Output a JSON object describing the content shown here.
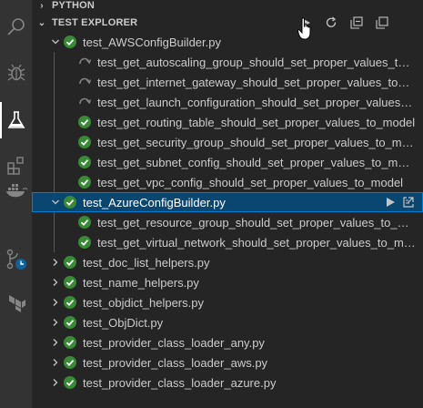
{
  "sections": {
    "python_label": "PYTHON",
    "test_explorer_label": "TEST EXPLORER"
  },
  "toolbar": {
    "icons": [
      "run-all-icon",
      "refresh-icon",
      "collapse-all-icon",
      "show-output-icon"
    ]
  },
  "colors": {
    "pass": "#388a34",
    "skipped": "#848484",
    "selection": "#094771",
    "focus_border": "#007fd4"
  },
  "tree": {
    "suite1": {
      "label": "test_AWSConfigBuilder.py",
      "tests": [
        {
          "label": "test_get_autoscaling_group_should_set_proper_values_to_model",
          "status": "skipped"
        },
        {
          "label": "test_get_internet_gateway_should_set_proper_values_to_model",
          "status": "skipped"
        },
        {
          "label": "test_get_launch_configuration_should_set_proper_values_to_model",
          "status": "skipped"
        },
        {
          "label": "test_get_routing_table_should_set_proper_values_to_model",
          "status": "passed"
        },
        {
          "label": "test_get_security_group_should_set_proper_values_to_model",
          "status": "passed"
        },
        {
          "label": "test_get_subnet_config_should_set_proper_values_to_model",
          "status": "passed"
        },
        {
          "label": "test_get_vpc_config_should_set_proper_values_to_model",
          "status": "passed"
        }
      ]
    },
    "suite2": {
      "label": "test_AzureConfigBuilder.py",
      "tests": [
        {
          "label": "test_get_resource_group_should_set_proper_values_to_model",
          "status": "passed"
        },
        {
          "label": "test_get_virtual_network_should_set_proper_values_to_model",
          "status": "passed"
        }
      ]
    },
    "collapsed_files": [
      "test_doc_list_helpers.py",
      "test_name_helpers.py",
      "test_objdict_helpers.py",
      "test_ObjDict.py",
      "test_provider_class_loader_any.py",
      "test_provider_class_loader_aws.py",
      "test_provider_class_loader_azure.py"
    ]
  }
}
